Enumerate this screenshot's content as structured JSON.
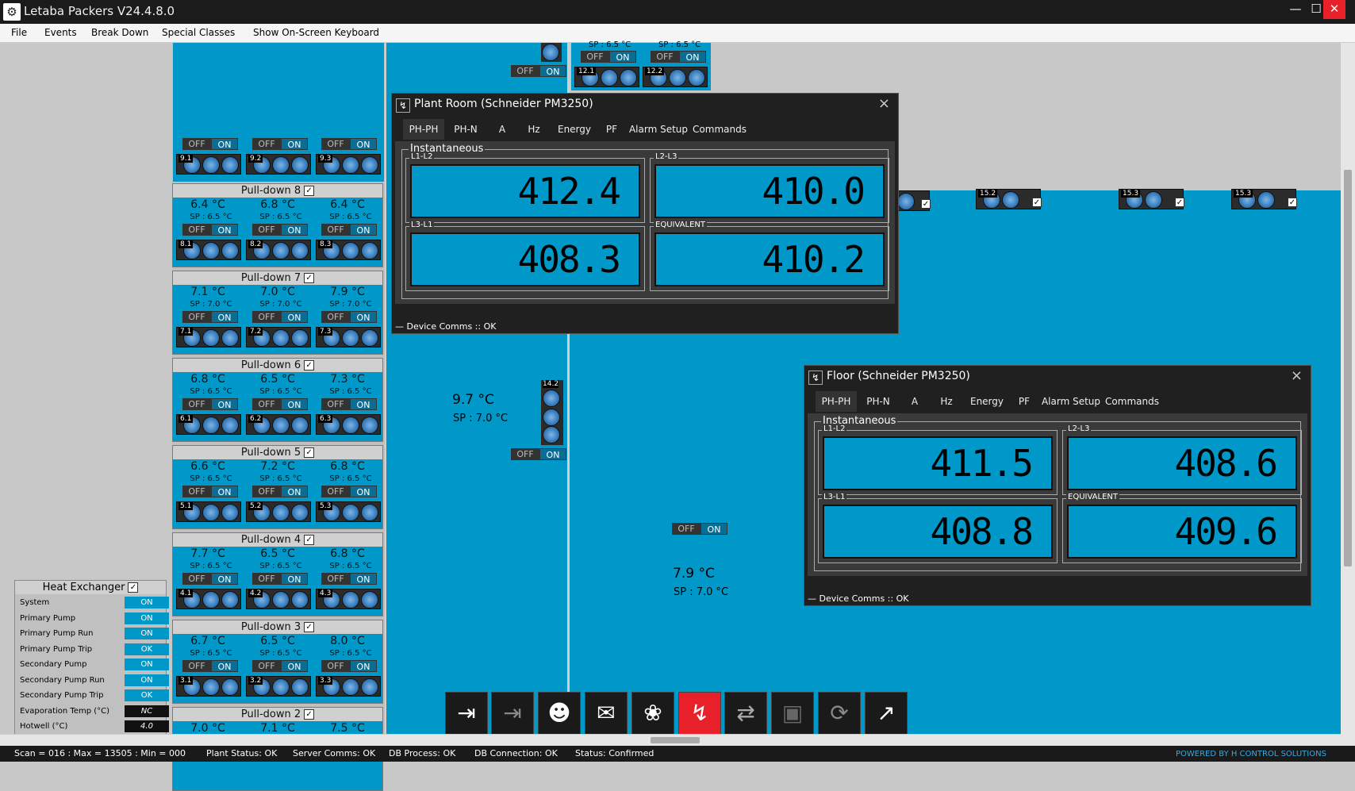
{
  "window": {
    "title": "Letaba Packers V24.4.8.0"
  },
  "menu": [
    "File",
    "Events",
    "Break Down",
    "Special Classes",
    "Show On-Screen Keyboard"
  ],
  "toggle": {
    "off": "OFF",
    "on": "ON"
  },
  "pulldowns": [
    {
      "name": "Pull-down 8",
      "temps": [
        "6.4 °C",
        "6.8 °C",
        "6.4 °C"
      ],
      "sps": [
        "SP : 6.5 °C",
        "SP : 6.5 °C",
        "SP : 6.5 °C"
      ],
      "fans": [
        "8.1",
        "8.2",
        "8.3"
      ]
    },
    {
      "name": "Pull-down 7",
      "temps": [
        "7.1 °C",
        "7.0 °C",
        "7.9 °C"
      ],
      "sps": [
        "SP : 7.0 °C",
        "SP : 7.0 °C",
        "SP : 7.0 °C"
      ],
      "fans": [
        "7.1",
        "7.2",
        "7.3"
      ]
    },
    {
      "name": "Pull-down 6",
      "temps": [
        "6.8 °C",
        "6.5 °C",
        "7.3 °C"
      ],
      "sps": [
        "SP : 6.5 °C",
        "SP : 6.5 °C",
        "SP : 6.5 °C"
      ],
      "fans": [
        "6.1",
        "6.2",
        "6.3"
      ]
    },
    {
      "name": "Pull-down 5",
      "temps": [
        "6.6 °C",
        "7.2 °C",
        "6.8 °C"
      ],
      "sps": [
        "SP : 6.5 °C",
        "SP : 6.5 °C",
        "SP : 6.5 °C"
      ],
      "fans": [
        "5.1",
        "5.2",
        "5.3"
      ]
    },
    {
      "name": "Pull-down 4",
      "temps": [
        "7.7 °C",
        "6.5 °C",
        "6.8 °C"
      ],
      "sps": [
        "SP : 6.5 °C",
        "SP : 6.5 °C",
        "SP : 6.5 °C"
      ],
      "fans": [
        "4.1",
        "4.2",
        "4.3"
      ]
    },
    {
      "name": "Pull-down 3",
      "temps": [
        "6.7 °C",
        "6.5 °C",
        "8.0 °C"
      ],
      "sps": [
        "SP : 6.5 °C",
        "SP : 6.5 °C",
        "SP : 6.5 °C"
      ],
      "fans": [
        "3.1",
        "3.2",
        "3.3"
      ]
    },
    {
      "name": "Pull-down 2",
      "temps": [
        "7.0 °C",
        "7.1 °C",
        "7.5 °C"
      ],
      "sps": [],
      "fans": []
    }
  ],
  "top_fans": [
    "9.1",
    "9.2",
    "9.3"
  ],
  "top_right_sp": [
    "SP : 6.5 °C",
    "SP : 6.5 °C"
  ],
  "top_right_fans": [
    "12.1",
    "12.2"
  ],
  "room_fans": [
    "15.2",
    "15.3",
    "15.3"
  ],
  "mid_fan": "14.2",
  "mid_temp": "9.7 °C",
  "mid_sp": "SP : 7.0 °C",
  "low_temp": "7.9 °C",
  "low_sp": "SP : 7.0 °C",
  "heat_exchanger": {
    "title": "Heat Exchanger",
    "rows": [
      {
        "k": "System",
        "v": "ON"
      },
      {
        "k": "Primary Pump",
        "v": "ON"
      },
      {
        "k": "Primary Pump Run",
        "v": "ON"
      },
      {
        "k": "Primary Pump Trip",
        "v": "OK"
      },
      {
        "k": "Secondary Pump",
        "v": "ON"
      },
      {
        "k": "Secondary Pump Run",
        "v": "ON"
      },
      {
        "k": "Secondary Pump Trip",
        "v": "OK"
      },
      {
        "k": "Evaporation Temp (°C)",
        "v": "NC"
      },
      {
        "k": "Hotwell (°C)",
        "v": "4.0"
      }
    ]
  },
  "meters": [
    {
      "title": "Plant Room (Schneider PM3250)",
      "tabs": [
        "PH-PH",
        "PH-N",
        "A",
        "Hz",
        "Energy",
        "PF",
        "Alarm Setup",
        "Commands"
      ],
      "group": "Instantaneous",
      "cells": [
        {
          "l": "L1-L2",
          "v": "412.4"
        },
        {
          "l": "L2-L3",
          "v": "410.0"
        },
        {
          "l": "L3-L1",
          "v": "408.3"
        },
        {
          "l": "EQUIVALENT",
          "v": "410.2"
        }
      ],
      "status": "Device Comms :: OK"
    },
    {
      "title": "Floor (Schneider PM3250)",
      "tabs": [
        "PH-PH",
        "PH-N",
        "A",
        "Hz",
        "Energy",
        "PF",
        "Alarm Setup",
        "Commands"
      ],
      "group": "Instantaneous",
      "cells": [
        {
          "l": "L1-L2",
          "v": "411.5"
        },
        {
          "l": "L2-L3",
          "v": "408.6"
        },
        {
          "l": "L3-L1",
          "v": "408.8"
        },
        {
          "l": "EQUIVALENT",
          "v": "409.6"
        }
      ],
      "status": "Device Comms :: OK"
    }
  ],
  "status": {
    "scan": "Scan = 016 : Max = 13505 : Min = 000",
    "plant": "Plant Status: OK",
    "server": "Server Comms: OK",
    "dbproc": "DB Process:  OK",
    "dbconn": "DB Connection:  OK",
    "st": "Status:  Confirmed",
    "powered": "POWERED BY H CONTROL SOLUTIONS"
  },
  "colors": {
    "accent": "#0098c8",
    "alarm": "#e8202a"
  }
}
